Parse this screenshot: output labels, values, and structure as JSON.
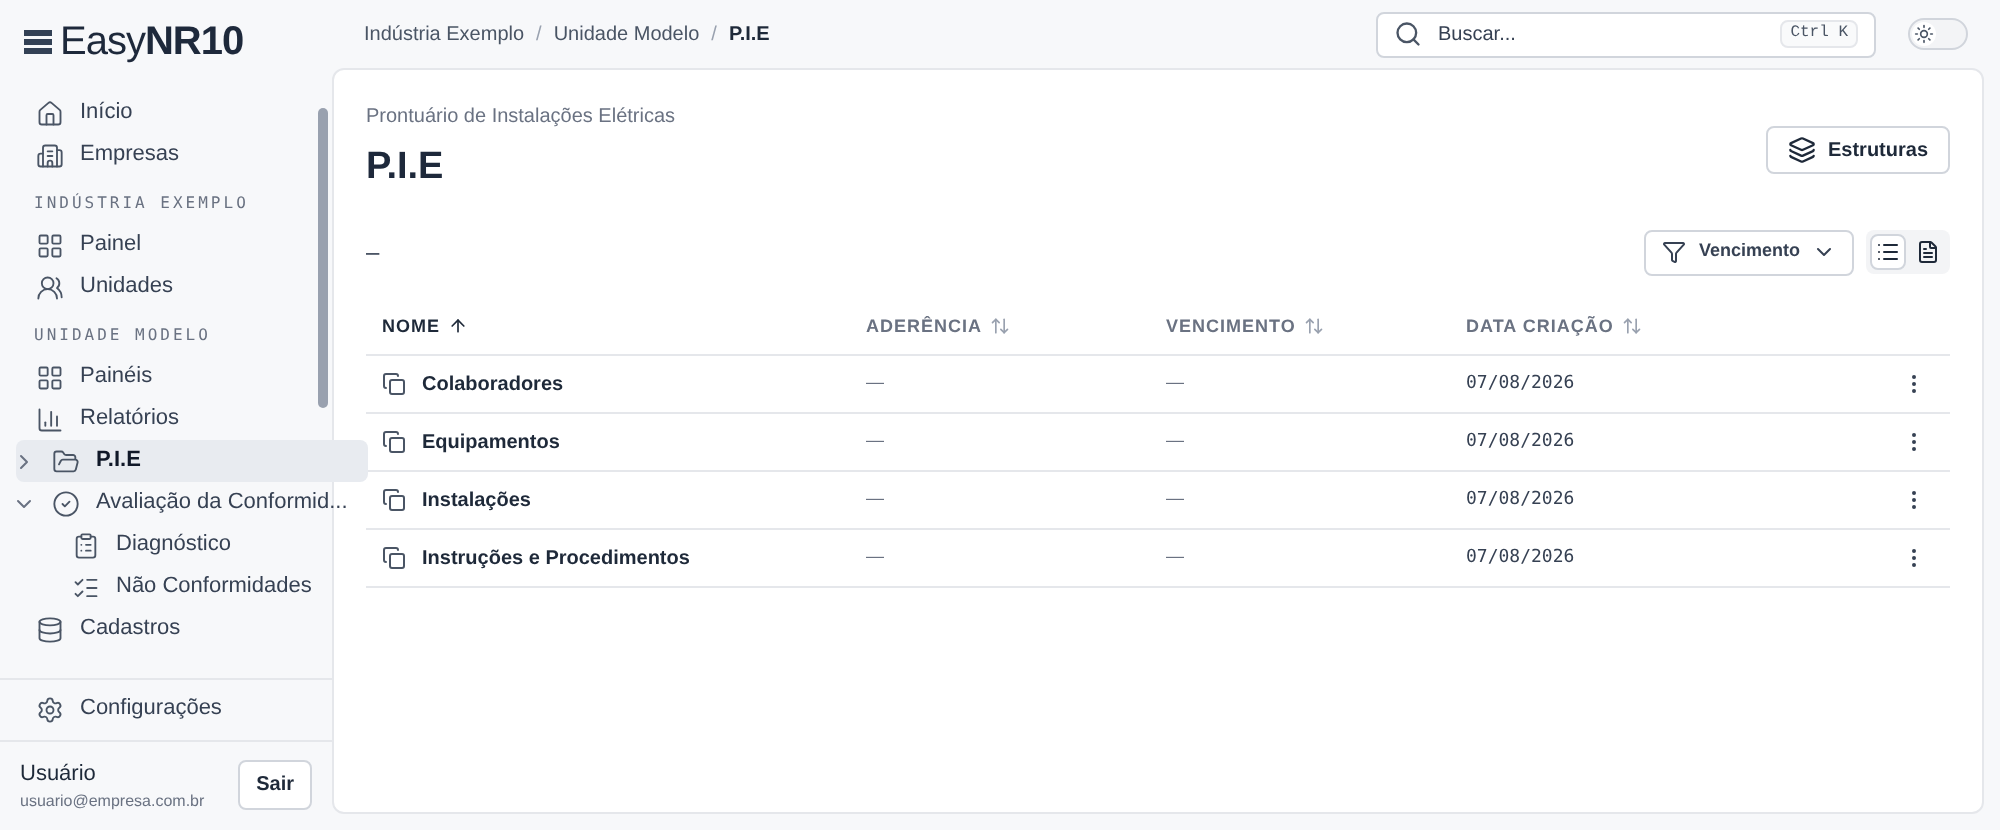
{
  "logo": {
    "text_light": "Easy",
    "text_bold": "NR10"
  },
  "sidebar": {
    "items": [
      {
        "kind": "item",
        "label": "Início",
        "selected": false
      },
      {
        "kind": "item",
        "label": "Empresas",
        "selected": false
      },
      {
        "kind": "section",
        "label": "INDÚSTRIA EXEMPLO"
      },
      {
        "kind": "item",
        "label": "Painel",
        "selected": false
      },
      {
        "kind": "item",
        "label": "Unidades",
        "selected": false
      },
      {
        "kind": "section",
        "label": "UNIDADE MODELO"
      },
      {
        "kind": "item",
        "label": "Painéis",
        "selected": false
      },
      {
        "kind": "item",
        "label": "Relatórios",
        "selected": false
      },
      {
        "kind": "group",
        "label": "P.I.E",
        "selected": true,
        "expanded": false
      },
      {
        "kind": "group",
        "label": "Avaliação da Conformid...",
        "selected": false,
        "expanded": true,
        "children": [
          {
            "label": "Diagnóstico",
            "selected": false
          },
          {
            "label": "Não Conformidades",
            "selected": false
          }
        ]
      },
      {
        "kind": "item",
        "label": "Cadastros",
        "selected": false
      }
    ],
    "settings": "Configurações",
    "user": {
      "name": "Usuário",
      "email": "usuario@empresa.com.br",
      "logout": "Sair"
    }
  },
  "breadcrumb": {
    "separator": "/",
    "items": [
      "Indústria Exemplo",
      "Unidade Modelo",
      "P.I.E"
    ]
  },
  "search": {
    "placeholder": "Buscar...",
    "shortcut": "Ctrl K"
  },
  "theme_toggle": {
    "on": false
  },
  "page": {
    "subtitle": "Prontuário de Instalações Elétricas",
    "title": "P.I.E",
    "structures_button": "Estruturas",
    "summary": "–",
    "filter": "Vencimento",
    "list_view_selected": true
  },
  "table": {
    "columns": [
      {
        "label": "NOME",
        "sorted": true
      },
      {
        "label": "ADERÊNCIA",
        "sorted": false
      },
      {
        "label": "VENCIMENTO",
        "sorted": false
      },
      {
        "label": "DATA CRIAÇÃO",
        "sorted": false
      }
    ],
    "rows": [
      {
        "name": "Colaboradores",
        "aderencia": "—",
        "vencimento": "—",
        "data": "07/08/2026"
      },
      {
        "name": "Equipamentos",
        "aderencia": "—",
        "vencimento": "—",
        "data": "07/08/2026"
      },
      {
        "name": "Instalações",
        "aderencia": "—",
        "vencimento": "—",
        "data": "07/08/2026"
      },
      {
        "name": "Instruções e Procedimentos",
        "aderencia": "—",
        "vencimento": "—",
        "data": "07/08/2026"
      }
    ]
  }
}
